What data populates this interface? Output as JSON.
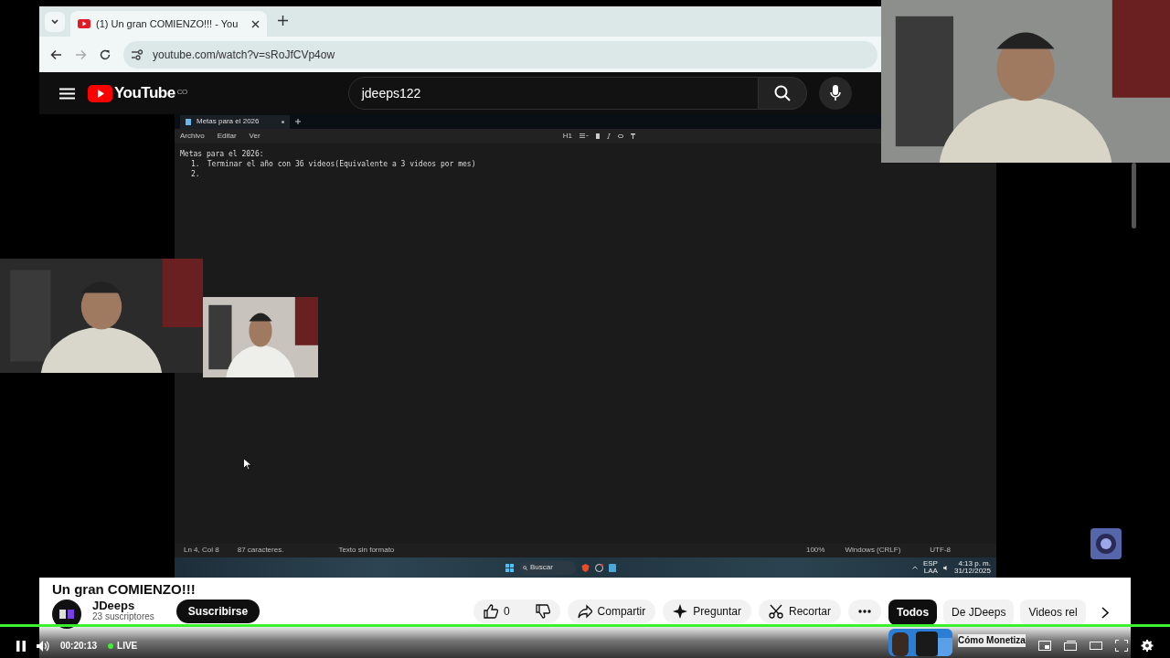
{
  "browser": {
    "tab_title": "(1) Un gran COMIENZO!!! - You",
    "url": "youtube.com/watch?v=sRoJfCVp4ow"
  },
  "youtube": {
    "logo": "YouTube",
    "country": "CO",
    "search": "jdeeps122"
  },
  "notepad": {
    "tab": "Metas para el 2026",
    "menu": [
      "Archivo",
      "Editar",
      "Ver"
    ],
    "heading_button": "H1",
    "lines": [
      {
        "kind": "heading",
        "text": "Metas para el 2026:"
      },
      {
        "kind": "item",
        "marker": "1.",
        "text": "Terminar el año con 36 videos(Equivalente a 3 videos por mes)"
      },
      {
        "kind": "item",
        "marker": "2."
      }
    ],
    "status": [
      "Ln 4, Col 8",
      "87 caracteres.",
      "Texto sin formato",
      "100%",
      "Windows (CRLF)",
      "UTF-8"
    ]
  },
  "taskbar": {
    "search": "Buscar",
    "language": "ESP",
    "layout": "LAA",
    "time": "4:13 p. m.",
    "date": "31/12/2025"
  },
  "video": {
    "title": "Un gran COMIENZO!!!",
    "channel": "JDeeps",
    "subscribers": "23 suscriptores",
    "subscribe": "Suscribirse",
    "likes": "0",
    "actions": [
      "Compartir",
      "Preguntar",
      "Recortar"
    ]
  },
  "chips": [
    {
      "label": "Todos",
      "selected": true
    },
    {
      "label": "De JDeeps",
      "selected": false
    },
    {
      "label": "Videos rel",
      "selected": false
    }
  ],
  "related": [
    {
      "title": "Cómo Monetiza"
    }
  ],
  "player": {
    "playing": true,
    "time": "00:20:13",
    "live": "LIVE",
    "level": 1
  }
}
